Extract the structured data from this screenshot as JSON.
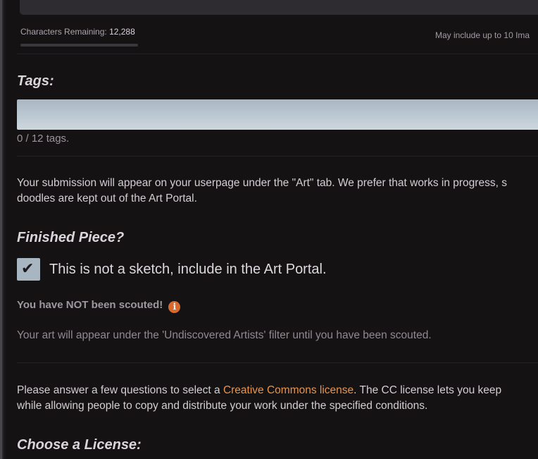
{
  "description_field": {
    "chars_label": "Characters Remaining:",
    "chars_value": "12,288",
    "images_note": "May include up to 10 Ima"
  },
  "tags": {
    "heading": "Tags:",
    "count_text": "0  / 12 tags."
  },
  "submission_info": {
    "line1": "Your submission will appear on your userpage under the \"Art\" tab. We prefer that works in progress, s",
    "line2": "doodles are kept out of the Art Portal."
  },
  "finished_piece": {
    "heading": "Finished Piece?",
    "checkbox_checked": true,
    "checkbox_label": "This is not a sketch, include in the Art Portal."
  },
  "scouting": {
    "status": "You have NOT been scouted!",
    "info_icon": "i",
    "note": "Your art will appear under the 'Undiscovered Artists' filter until you have been scouted."
  },
  "license": {
    "intro_before": "Please answer a few questions to select a ",
    "link_text": "Creative Commons license",
    "intro_after": ". The CC license lets you keep",
    "line2": "while allowing people to copy and distribute your work under the specified conditions.",
    "heading": "Choose a License:"
  },
  "colors": {
    "background": "#151214",
    "link": "#e8944a",
    "info_icon": "#d8692e",
    "input": "#bcc8d1"
  }
}
